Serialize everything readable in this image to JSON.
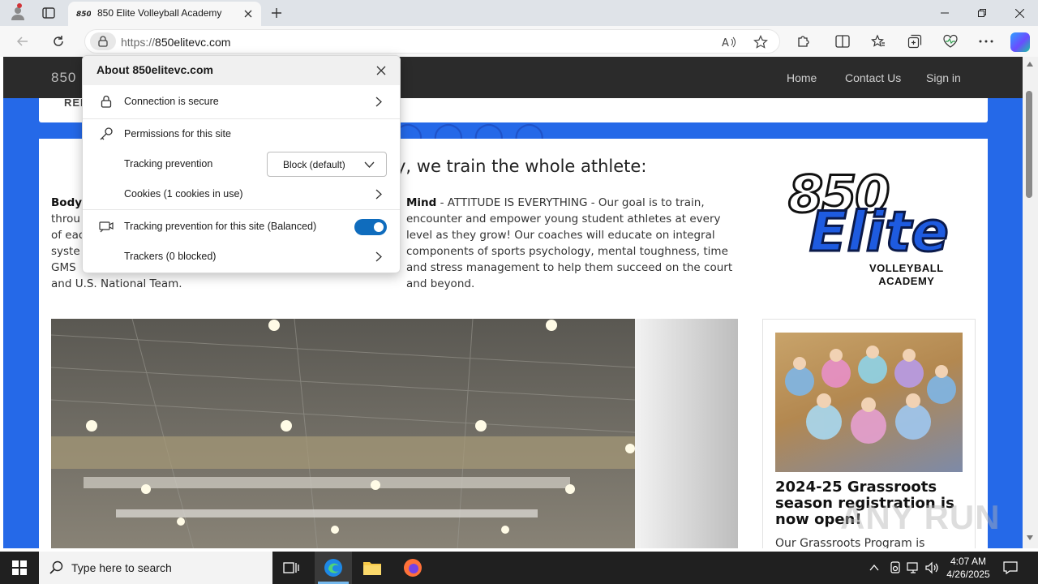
{
  "browser": {
    "tab_title": "850 Elite Volleyball Academy",
    "url_scheme": "https://",
    "url_host": "850elitevc.com"
  },
  "site": {
    "brand": "850",
    "nav": [
      "Home",
      "Contact Us",
      "Sign in"
    ],
    "top_card_label": "REI",
    "heading": "y, we train the whole athlete:",
    "body_col_lines": [
      "Body",
      "throu",
      "of eac",
      "syste",
      "GMS",
      "and U.S. National Team."
    ],
    "mind_label": "Mind",
    "mind_text": " - ATTITUDE IS EVERYTHING - Our goal is to train, encounter and empower young student athletes at every level as they grow! Our coaches will educate on integral components of sports psychology, mental toughness, time and stress management to help them succeed on the court and beyond.",
    "logo": {
      "line1": "850",
      "line2": "Elite",
      "sub1": "VOLLEYBALL",
      "sub2": "ACADEMY"
    },
    "news_title": "2024-25 Grassroots season registration is now open!",
    "news_text": "Our Grassroots Program is"
  },
  "popup": {
    "title": "About 850elitevc.com",
    "connection": "Connection is secure",
    "permissions": "Permissions for this site",
    "tracking_label": "Tracking prevention",
    "tracking_value": "Block (default)",
    "cookies": "Cookies (1 cookies in use)",
    "tracking_site": "Tracking prevention for this site (Balanced)",
    "tracking_site_on": true,
    "trackers": "Trackers (0 blocked)"
  },
  "taskbar": {
    "search_placeholder": "Type here to search",
    "time": "4:07 AM",
    "date": "4/26/2025"
  },
  "watermark": "ANY RUN",
  "colors": {
    "accent": "#0f6cbd",
    "site_blue": "#2569e8",
    "nav_dark": "#2b2b2b"
  }
}
